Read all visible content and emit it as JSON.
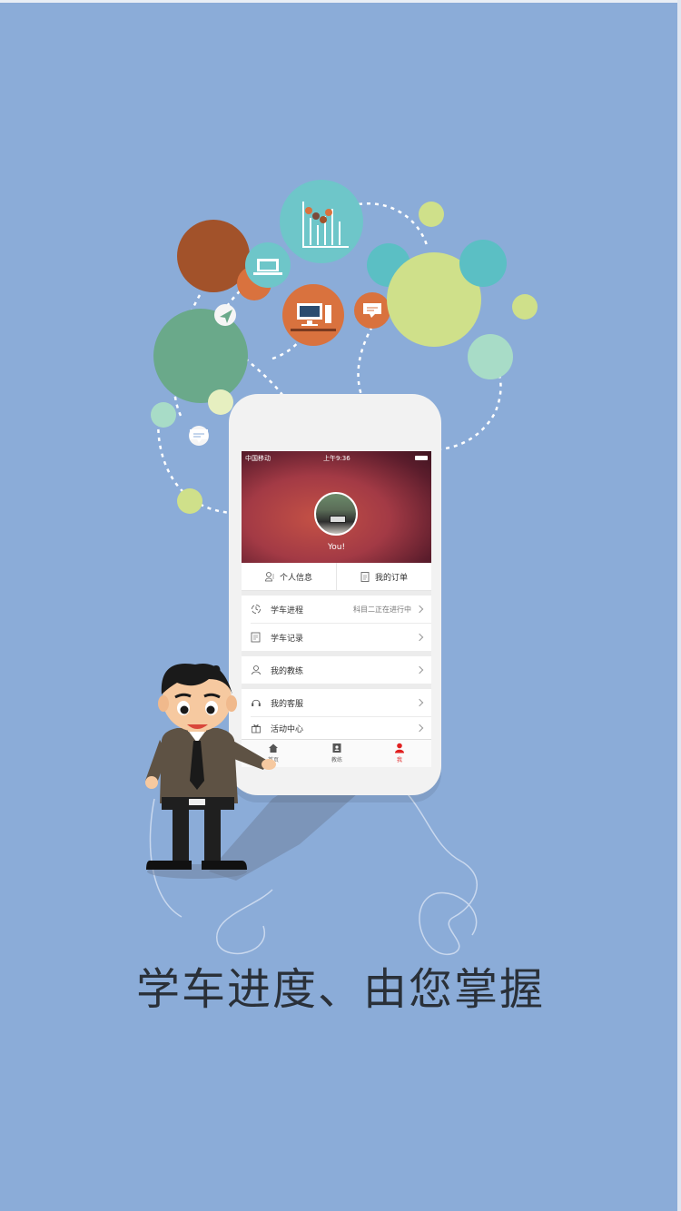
{
  "screen": {
    "status_carrier": "中国移动",
    "status_time": "上午9:36",
    "username": "You!"
  },
  "quick_actions": [
    {
      "label": "个人信息",
      "icon": "person-info-icon"
    },
    {
      "label": "我的订单",
      "icon": "order-doc-icon"
    }
  ],
  "menu": {
    "progress_label": "学车进程",
    "progress_value": "科目二正在进行中",
    "record_label": "学车记录",
    "coach_label": "我的教练",
    "service_label": "我的客服",
    "activity_label": "活动中心"
  },
  "tabbar": {
    "home": "首页",
    "coach": "教练",
    "me": "我"
  },
  "tagline": "学车进度、由您掌握",
  "colors": {
    "background": "#8bacd8",
    "accent": "#e02020",
    "bubble_teal": "#6ec6c9",
    "bubble_green": "#6aa98a",
    "bubble_lime": "#cfe08a",
    "bubble_brown": "#a2522a",
    "bubble_orange": "#d9723e"
  }
}
